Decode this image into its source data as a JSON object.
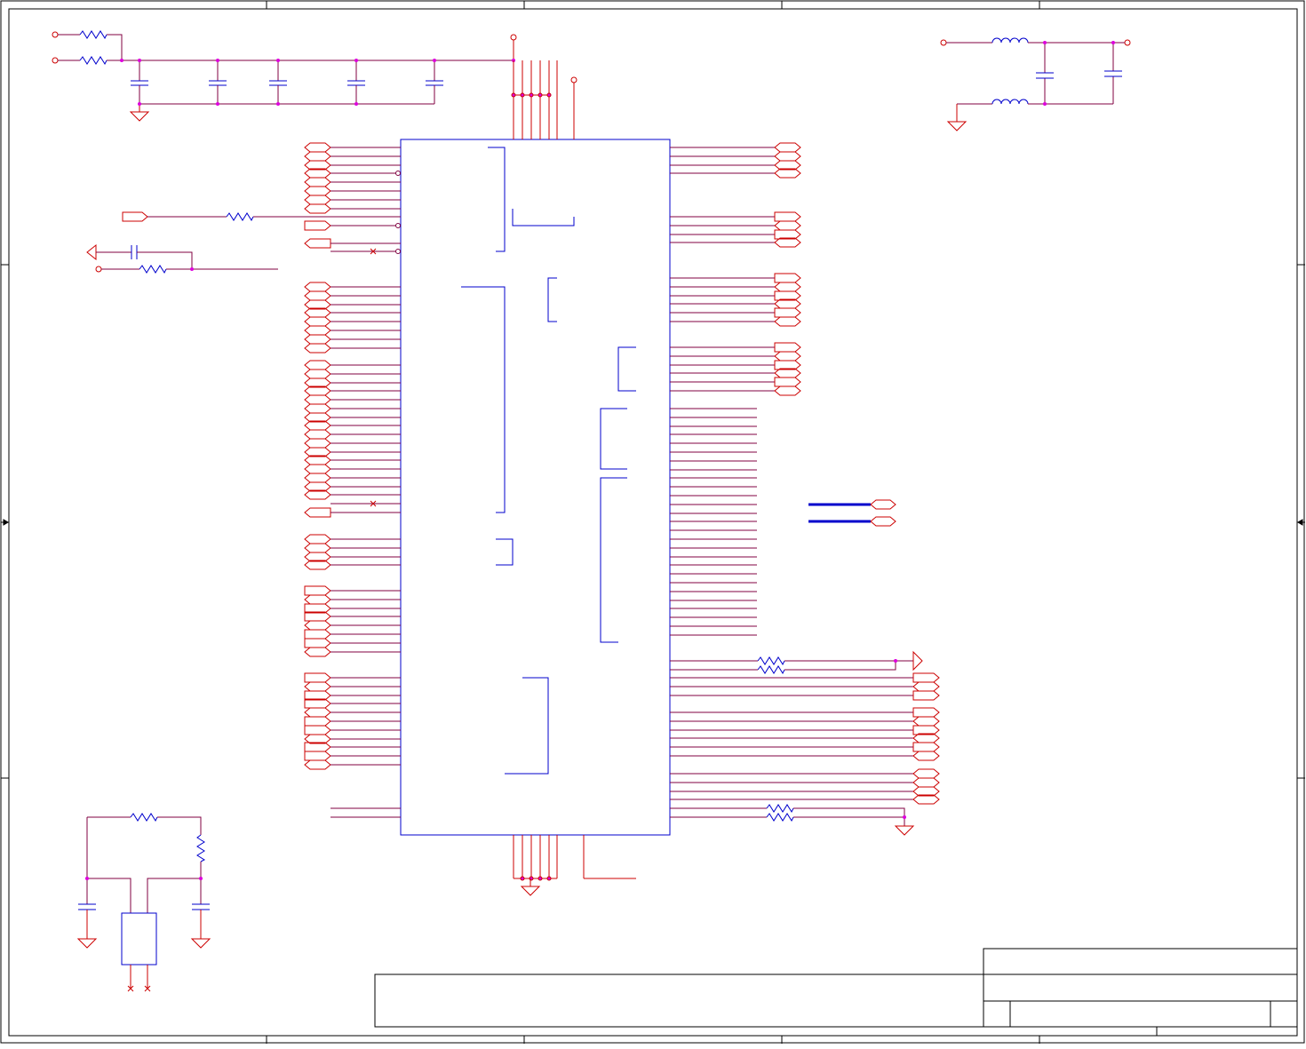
{
  "sheet": {
    "zone_columns": [
      "",
      "",
      "",
      "",
      ""
    ],
    "zone_rows": [
      "",
      "",
      "",
      ""
    ]
  },
  "title_block": {
    "company": "",
    "title": "",
    "size": "",
    "document_number": "",
    "revision": "",
    "date": "",
    "sheet": "",
    "notes": ""
  },
  "colors": {
    "wire": "#cc0000",
    "net_wire": "#800040",
    "component": "#0000cc",
    "junction": "#dd00dd",
    "border": "#000000",
    "background": "#ffffff"
  },
  "icons": [
    "ground-symbol",
    "resistor",
    "capacitor",
    "inductor",
    "net-port",
    "no-connect-marker",
    "power-pin-circle",
    "junction-dot"
  ]
}
